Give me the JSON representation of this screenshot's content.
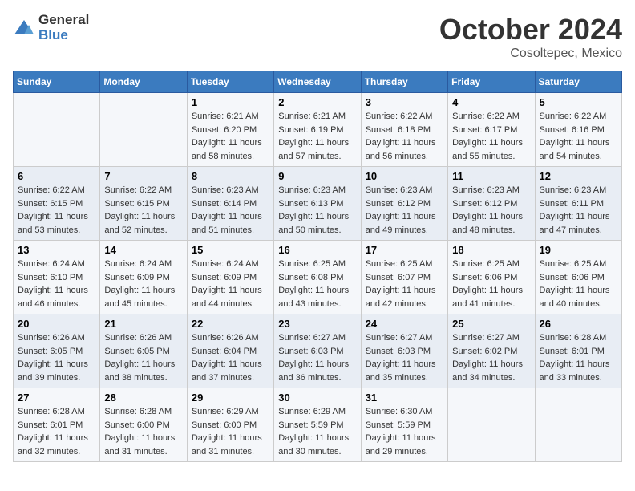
{
  "header": {
    "logo_general": "General",
    "logo_blue": "Blue",
    "month": "October 2024",
    "location": "Cosoltepec, Mexico"
  },
  "weekdays": [
    "Sunday",
    "Monday",
    "Tuesday",
    "Wednesday",
    "Thursday",
    "Friday",
    "Saturday"
  ],
  "weeks": [
    [
      {
        "day": null,
        "sunrise": null,
        "sunset": null,
        "daylight": null
      },
      {
        "day": null,
        "sunrise": null,
        "sunset": null,
        "daylight": null
      },
      {
        "day": "1",
        "sunrise": "Sunrise: 6:21 AM",
        "sunset": "Sunset: 6:20 PM",
        "daylight": "Daylight: 11 hours and 58 minutes."
      },
      {
        "day": "2",
        "sunrise": "Sunrise: 6:21 AM",
        "sunset": "Sunset: 6:19 PM",
        "daylight": "Daylight: 11 hours and 57 minutes."
      },
      {
        "day": "3",
        "sunrise": "Sunrise: 6:22 AM",
        "sunset": "Sunset: 6:18 PM",
        "daylight": "Daylight: 11 hours and 56 minutes."
      },
      {
        "day": "4",
        "sunrise": "Sunrise: 6:22 AM",
        "sunset": "Sunset: 6:17 PM",
        "daylight": "Daylight: 11 hours and 55 minutes."
      },
      {
        "day": "5",
        "sunrise": "Sunrise: 6:22 AM",
        "sunset": "Sunset: 6:16 PM",
        "daylight": "Daylight: 11 hours and 54 minutes."
      }
    ],
    [
      {
        "day": "6",
        "sunrise": "Sunrise: 6:22 AM",
        "sunset": "Sunset: 6:15 PM",
        "daylight": "Daylight: 11 hours and 53 minutes."
      },
      {
        "day": "7",
        "sunrise": "Sunrise: 6:22 AM",
        "sunset": "Sunset: 6:15 PM",
        "daylight": "Daylight: 11 hours and 52 minutes."
      },
      {
        "day": "8",
        "sunrise": "Sunrise: 6:23 AM",
        "sunset": "Sunset: 6:14 PM",
        "daylight": "Daylight: 11 hours and 51 minutes."
      },
      {
        "day": "9",
        "sunrise": "Sunrise: 6:23 AM",
        "sunset": "Sunset: 6:13 PM",
        "daylight": "Daylight: 11 hours and 50 minutes."
      },
      {
        "day": "10",
        "sunrise": "Sunrise: 6:23 AM",
        "sunset": "Sunset: 6:12 PM",
        "daylight": "Daylight: 11 hours and 49 minutes."
      },
      {
        "day": "11",
        "sunrise": "Sunrise: 6:23 AM",
        "sunset": "Sunset: 6:12 PM",
        "daylight": "Daylight: 11 hours and 48 minutes."
      },
      {
        "day": "12",
        "sunrise": "Sunrise: 6:23 AM",
        "sunset": "Sunset: 6:11 PM",
        "daylight": "Daylight: 11 hours and 47 minutes."
      }
    ],
    [
      {
        "day": "13",
        "sunrise": "Sunrise: 6:24 AM",
        "sunset": "Sunset: 6:10 PM",
        "daylight": "Daylight: 11 hours and 46 minutes."
      },
      {
        "day": "14",
        "sunrise": "Sunrise: 6:24 AM",
        "sunset": "Sunset: 6:09 PM",
        "daylight": "Daylight: 11 hours and 45 minutes."
      },
      {
        "day": "15",
        "sunrise": "Sunrise: 6:24 AM",
        "sunset": "Sunset: 6:09 PM",
        "daylight": "Daylight: 11 hours and 44 minutes."
      },
      {
        "day": "16",
        "sunrise": "Sunrise: 6:25 AM",
        "sunset": "Sunset: 6:08 PM",
        "daylight": "Daylight: 11 hours and 43 minutes."
      },
      {
        "day": "17",
        "sunrise": "Sunrise: 6:25 AM",
        "sunset": "Sunset: 6:07 PM",
        "daylight": "Daylight: 11 hours and 42 minutes."
      },
      {
        "day": "18",
        "sunrise": "Sunrise: 6:25 AM",
        "sunset": "Sunset: 6:06 PM",
        "daylight": "Daylight: 11 hours and 41 minutes."
      },
      {
        "day": "19",
        "sunrise": "Sunrise: 6:25 AM",
        "sunset": "Sunset: 6:06 PM",
        "daylight": "Daylight: 11 hours and 40 minutes."
      }
    ],
    [
      {
        "day": "20",
        "sunrise": "Sunrise: 6:26 AM",
        "sunset": "Sunset: 6:05 PM",
        "daylight": "Daylight: 11 hours and 39 minutes."
      },
      {
        "day": "21",
        "sunrise": "Sunrise: 6:26 AM",
        "sunset": "Sunset: 6:05 PM",
        "daylight": "Daylight: 11 hours and 38 minutes."
      },
      {
        "day": "22",
        "sunrise": "Sunrise: 6:26 AM",
        "sunset": "Sunset: 6:04 PM",
        "daylight": "Daylight: 11 hours and 37 minutes."
      },
      {
        "day": "23",
        "sunrise": "Sunrise: 6:27 AM",
        "sunset": "Sunset: 6:03 PM",
        "daylight": "Daylight: 11 hours and 36 minutes."
      },
      {
        "day": "24",
        "sunrise": "Sunrise: 6:27 AM",
        "sunset": "Sunset: 6:03 PM",
        "daylight": "Daylight: 11 hours and 35 minutes."
      },
      {
        "day": "25",
        "sunrise": "Sunrise: 6:27 AM",
        "sunset": "Sunset: 6:02 PM",
        "daylight": "Daylight: 11 hours and 34 minutes."
      },
      {
        "day": "26",
        "sunrise": "Sunrise: 6:28 AM",
        "sunset": "Sunset: 6:01 PM",
        "daylight": "Daylight: 11 hours and 33 minutes."
      }
    ],
    [
      {
        "day": "27",
        "sunrise": "Sunrise: 6:28 AM",
        "sunset": "Sunset: 6:01 PM",
        "daylight": "Daylight: 11 hours and 32 minutes."
      },
      {
        "day": "28",
        "sunrise": "Sunrise: 6:28 AM",
        "sunset": "Sunset: 6:00 PM",
        "daylight": "Daylight: 11 hours and 31 minutes."
      },
      {
        "day": "29",
        "sunrise": "Sunrise: 6:29 AM",
        "sunset": "Sunset: 6:00 PM",
        "daylight": "Daylight: 11 hours and 31 minutes."
      },
      {
        "day": "30",
        "sunrise": "Sunrise: 6:29 AM",
        "sunset": "Sunset: 5:59 PM",
        "daylight": "Daylight: 11 hours and 30 minutes."
      },
      {
        "day": "31",
        "sunrise": "Sunrise: 6:30 AM",
        "sunset": "Sunset: 5:59 PM",
        "daylight": "Daylight: 11 hours and 29 minutes."
      },
      {
        "day": null,
        "sunrise": null,
        "sunset": null,
        "daylight": null
      },
      {
        "day": null,
        "sunrise": null,
        "sunset": null,
        "daylight": null
      }
    ]
  ]
}
